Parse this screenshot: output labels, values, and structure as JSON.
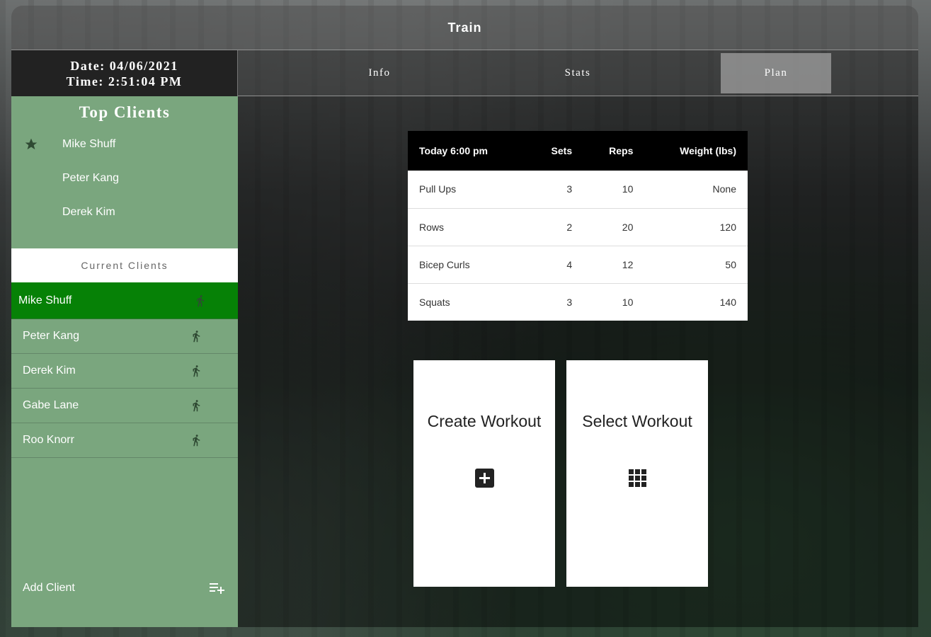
{
  "app": {
    "title": "Train"
  },
  "datetime": {
    "date": "Date: 04/06/2021",
    "time": "Time: 2:51:04 PM"
  },
  "tabs": [
    {
      "label": "Info",
      "active": false
    },
    {
      "label": "Stats",
      "active": false
    },
    {
      "label": "Plan",
      "active": true
    }
  ],
  "sidebar": {
    "top_clients_title": "Top Clients",
    "top_clients": [
      "Mike Shuff",
      "Peter Kang",
      "Derek Kim"
    ],
    "current_clients_title": "Current Clients",
    "current_clients": [
      {
        "name": "Mike Shuff",
        "selected": true
      },
      {
        "name": "Peter Kang",
        "selected": false
      },
      {
        "name": "Derek Kim",
        "selected": false
      },
      {
        "name": "Gabe Lane",
        "selected": false
      },
      {
        "name": "Roo Knorr",
        "selected": false
      }
    ],
    "add_client_label": "Add Client"
  },
  "workout_table": {
    "headers": [
      "Today 6:00 pm",
      "Sets",
      "Reps",
      "Weight (lbs)"
    ],
    "rows": [
      [
        "Pull Ups",
        "3",
        "10",
        "None"
      ],
      [
        "Rows",
        "2",
        "20",
        "120"
      ],
      [
        "Bicep Curls",
        "4",
        "12",
        "50"
      ],
      [
        "Squats",
        "3",
        "10",
        "140"
      ]
    ]
  },
  "cards": {
    "create_label": "Create Workout",
    "select_label": "Select Workout"
  },
  "colors": {
    "sidebar_bg": "#7aa67e",
    "selected_client": "#068106"
  },
  "icons": {
    "star": "star-icon",
    "run": "run-icon",
    "add_list": "playlist-add-icon",
    "add_box": "add-box-icon",
    "grid": "grid-icon"
  }
}
